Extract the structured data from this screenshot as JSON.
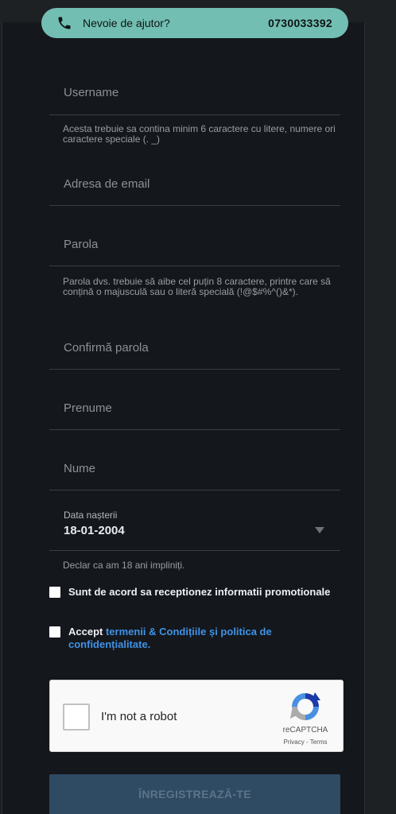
{
  "help": {
    "text": "Nevoie de ajutor?",
    "phone": "0730033392",
    "color": "#72beb2"
  },
  "form": {
    "username_label": "Username",
    "username_hint": "Acesta trebuie sa contina minim 6 caractere cu litere, numere ori caractere speciale (. _)",
    "email_label": "Adresa de email",
    "password_label": "Parola",
    "password_hint": "Parola dvs. trebuie să aibe cel puțin 8 caractere, printre care să conțină o majusculă sau o literă specială (!@$#%^()&*).",
    "confirm_password_label": "Confirmă parola",
    "first_name_label": "Prenume",
    "last_name_label": "Nume",
    "dob_label": "Data nașterii",
    "dob_value": "18-01-2004",
    "age_declaration": "Declar ca am 18 ani impliniți.",
    "promo_consent": "Sunt de acord sa receptionez informatii promotionale",
    "terms_prefix": "Accept ",
    "terms_link": "termenii & Condițiile și politica de confidențialitate",
    "terms_suffix": ".",
    "submit_label": "ÎNREGISTREAZĂ-TE",
    "accent_color": "#3f93e8"
  },
  "recaptcha": {
    "label": "I'm not a robot",
    "brand": "reCAPTCHA",
    "privacy": "Privacy",
    "separator": " - ",
    "terms": "Terms"
  }
}
